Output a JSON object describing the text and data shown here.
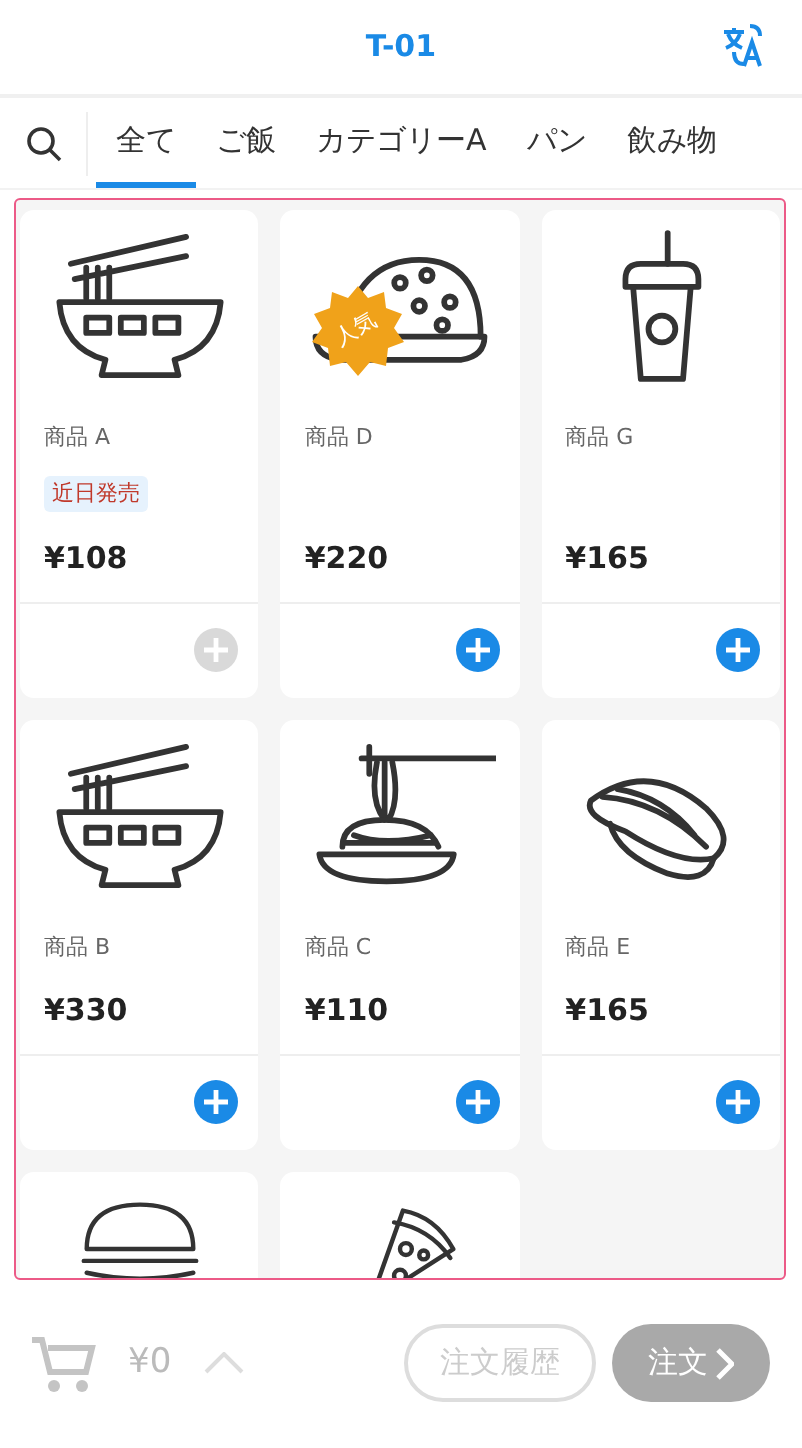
{
  "header": {
    "title": "T-01"
  },
  "tabs": [
    {
      "label": "全て",
      "selected": true
    },
    {
      "label": "ご飯",
      "selected": false
    },
    {
      "label": "カテゴリーA",
      "selected": false
    },
    {
      "label": "パン",
      "selected": false
    },
    {
      "label": "飲み物",
      "selected": false
    }
  ],
  "products": [
    {
      "kind": "ramen",
      "name": "商品 A",
      "tag": "近日発売",
      "price": "¥108",
      "add_disabled": true
    },
    {
      "kind": "curry",
      "name": "商品 D",
      "badge": "人気",
      "price": "¥220",
      "add_disabled": false
    },
    {
      "kind": "drink",
      "name": "商品 G",
      "price": "¥165",
      "add_disabled": false
    },
    {
      "kind": "ramen",
      "name": "商品 B",
      "price": "¥330",
      "add_disabled": false
    },
    {
      "kind": "spaghetti",
      "name": "商品 C",
      "price": "¥110",
      "add_disabled": false
    },
    {
      "kind": "sushi",
      "name": "商品 E",
      "price": "¥165",
      "add_disabled": false
    },
    {
      "kind": "burger"
    },
    {
      "kind": "pizza"
    }
  ],
  "footer": {
    "total": "¥0",
    "history_button": {
      "label": "注文履歴",
      "disabled": true
    },
    "order_button": {
      "label": "注文",
      "disabled": true
    }
  }
}
